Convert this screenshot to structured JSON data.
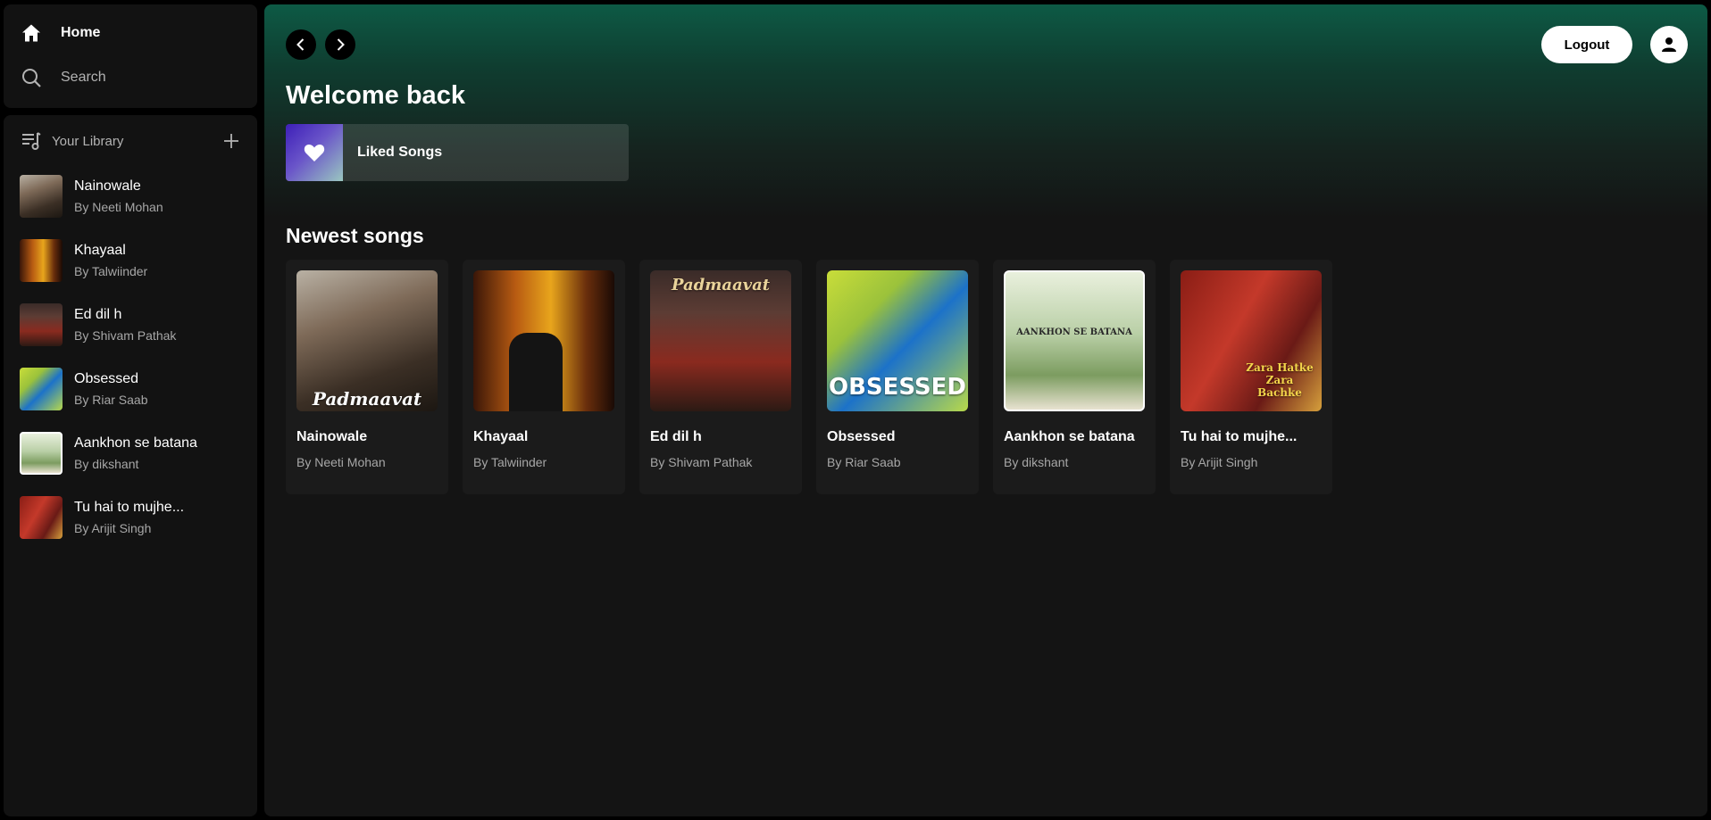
{
  "nav": {
    "home_label": "Home",
    "search_label": "Search"
  },
  "library": {
    "title": "Your Library",
    "items": [
      {
        "title": "Nainowale",
        "artist": "By Neeti Mohan"
      },
      {
        "title": "Khayaal",
        "artist": "By Talwiinder"
      },
      {
        "title": "Ed dil h",
        "artist": "By Shivam Pathak"
      },
      {
        "title": "Obsessed",
        "artist": "By Riar Saab"
      },
      {
        "title": "Aankhon se batana",
        "artist": "By dikshant"
      },
      {
        "title": "Tu hai to mujhe...",
        "artist": "By Arijit Singh"
      }
    ]
  },
  "header": {
    "logout_label": "Logout"
  },
  "main": {
    "welcome": "Welcome back",
    "liked_songs_label": "Liked Songs",
    "section_title": "Newest songs",
    "songs": [
      {
        "title": "Nainowale",
        "artist": "By Neeti Mohan",
        "art_text": "Padmaavat"
      },
      {
        "title": "Khayaal",
        "artist": "By Talwiinder",
        "art_text": ""
      },
      {
        "title": "Ed dil h",
        "artist": "By Shivam Pathak",
        "art_text": "Padmaavat"
      },
      {
        "title": "Obsessed",
        "artist": "By Riar Saab",
        "art_text": "OBSESSED"
      },
      {
        "title": "Aankhon se batana",
        "artist": "By dikshant",
        "art_text": "AANKHON SE BATANA"
      },
      {
        "title": "Tu hai to mujhe...",
        "artist": "By Arijit Singh",
        "art_text": "Zara Hatke Zara Bachke"
      }
    ]
  },
  "colors": {
    "accent_green": "#0d5a45",
    "background": "#121212",
    "card": "#1b1b1b"
  }
}
